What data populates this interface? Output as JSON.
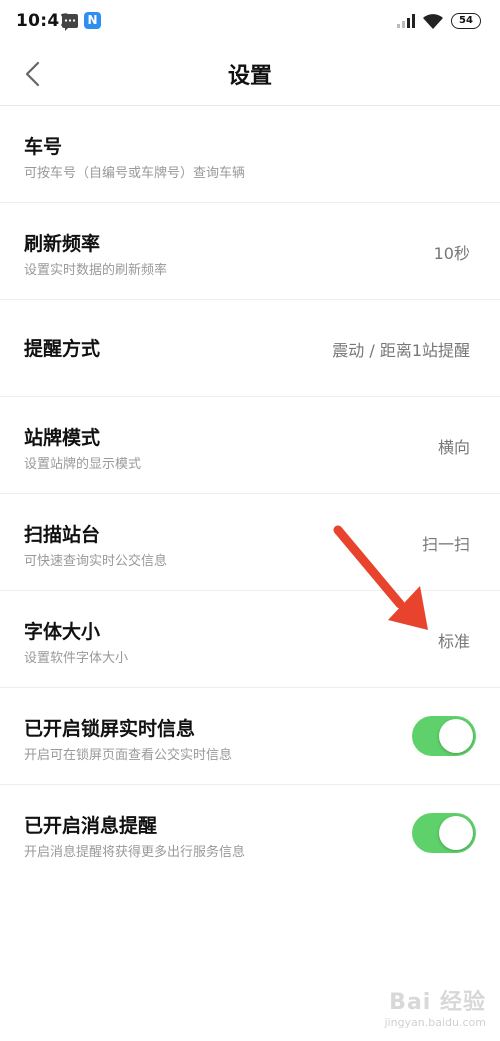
{
  "status_bar": {
    "time": "10:41",
    "app_badge": "N",
    "battery": "54"
  },
  "nav": {
    "title": "设置"
  },
  "settings": [
    {
      "title": "车号",
      "subtitle": "可按车号（自编号或车牌号）查询车辆",
      "value": ""
    },
    {
      "title": "刷新频率",
      "subtitle": "设置实时数据的刷新频率",
      "value": "10秒"
    },
    {
      "title": "提醒方式",
      "subtitle": "",
      "value": "震动 / 距离1站提醒"
    },
    {
      "title": "站牌模式",
      "subtitle": "设置站牌的显示模式",
      "value": "横向"
    },
    {
      "title": "扫描站台",
      "subtitle": "可快速查询实时公交信息",
      "value": "扫一扫"
    },
    {
      "title": "字体大小",
      "subtitle": "设置软件字体大小",
      "value": "标准"
    },
    {
      "title": "已开启锁屏实时信息",
      "subtitle": "开启可在锁屏页面查看公交实时信息",
      "toggle": true
    },
    {
      "title": "已开启消息提醒",
      "subtitle": "开启消息提醒将获得更多出行服务信息",
      "toggle": true
    }
  ],
  "watermark": {
    "logo": "Bai 经验",
    "url": "jingyan.baidu.com"
  },
  "colors": {
    "toggle_on": "#5fd16a",
    "annotation_arrow": "#e8432d"
  }
}
